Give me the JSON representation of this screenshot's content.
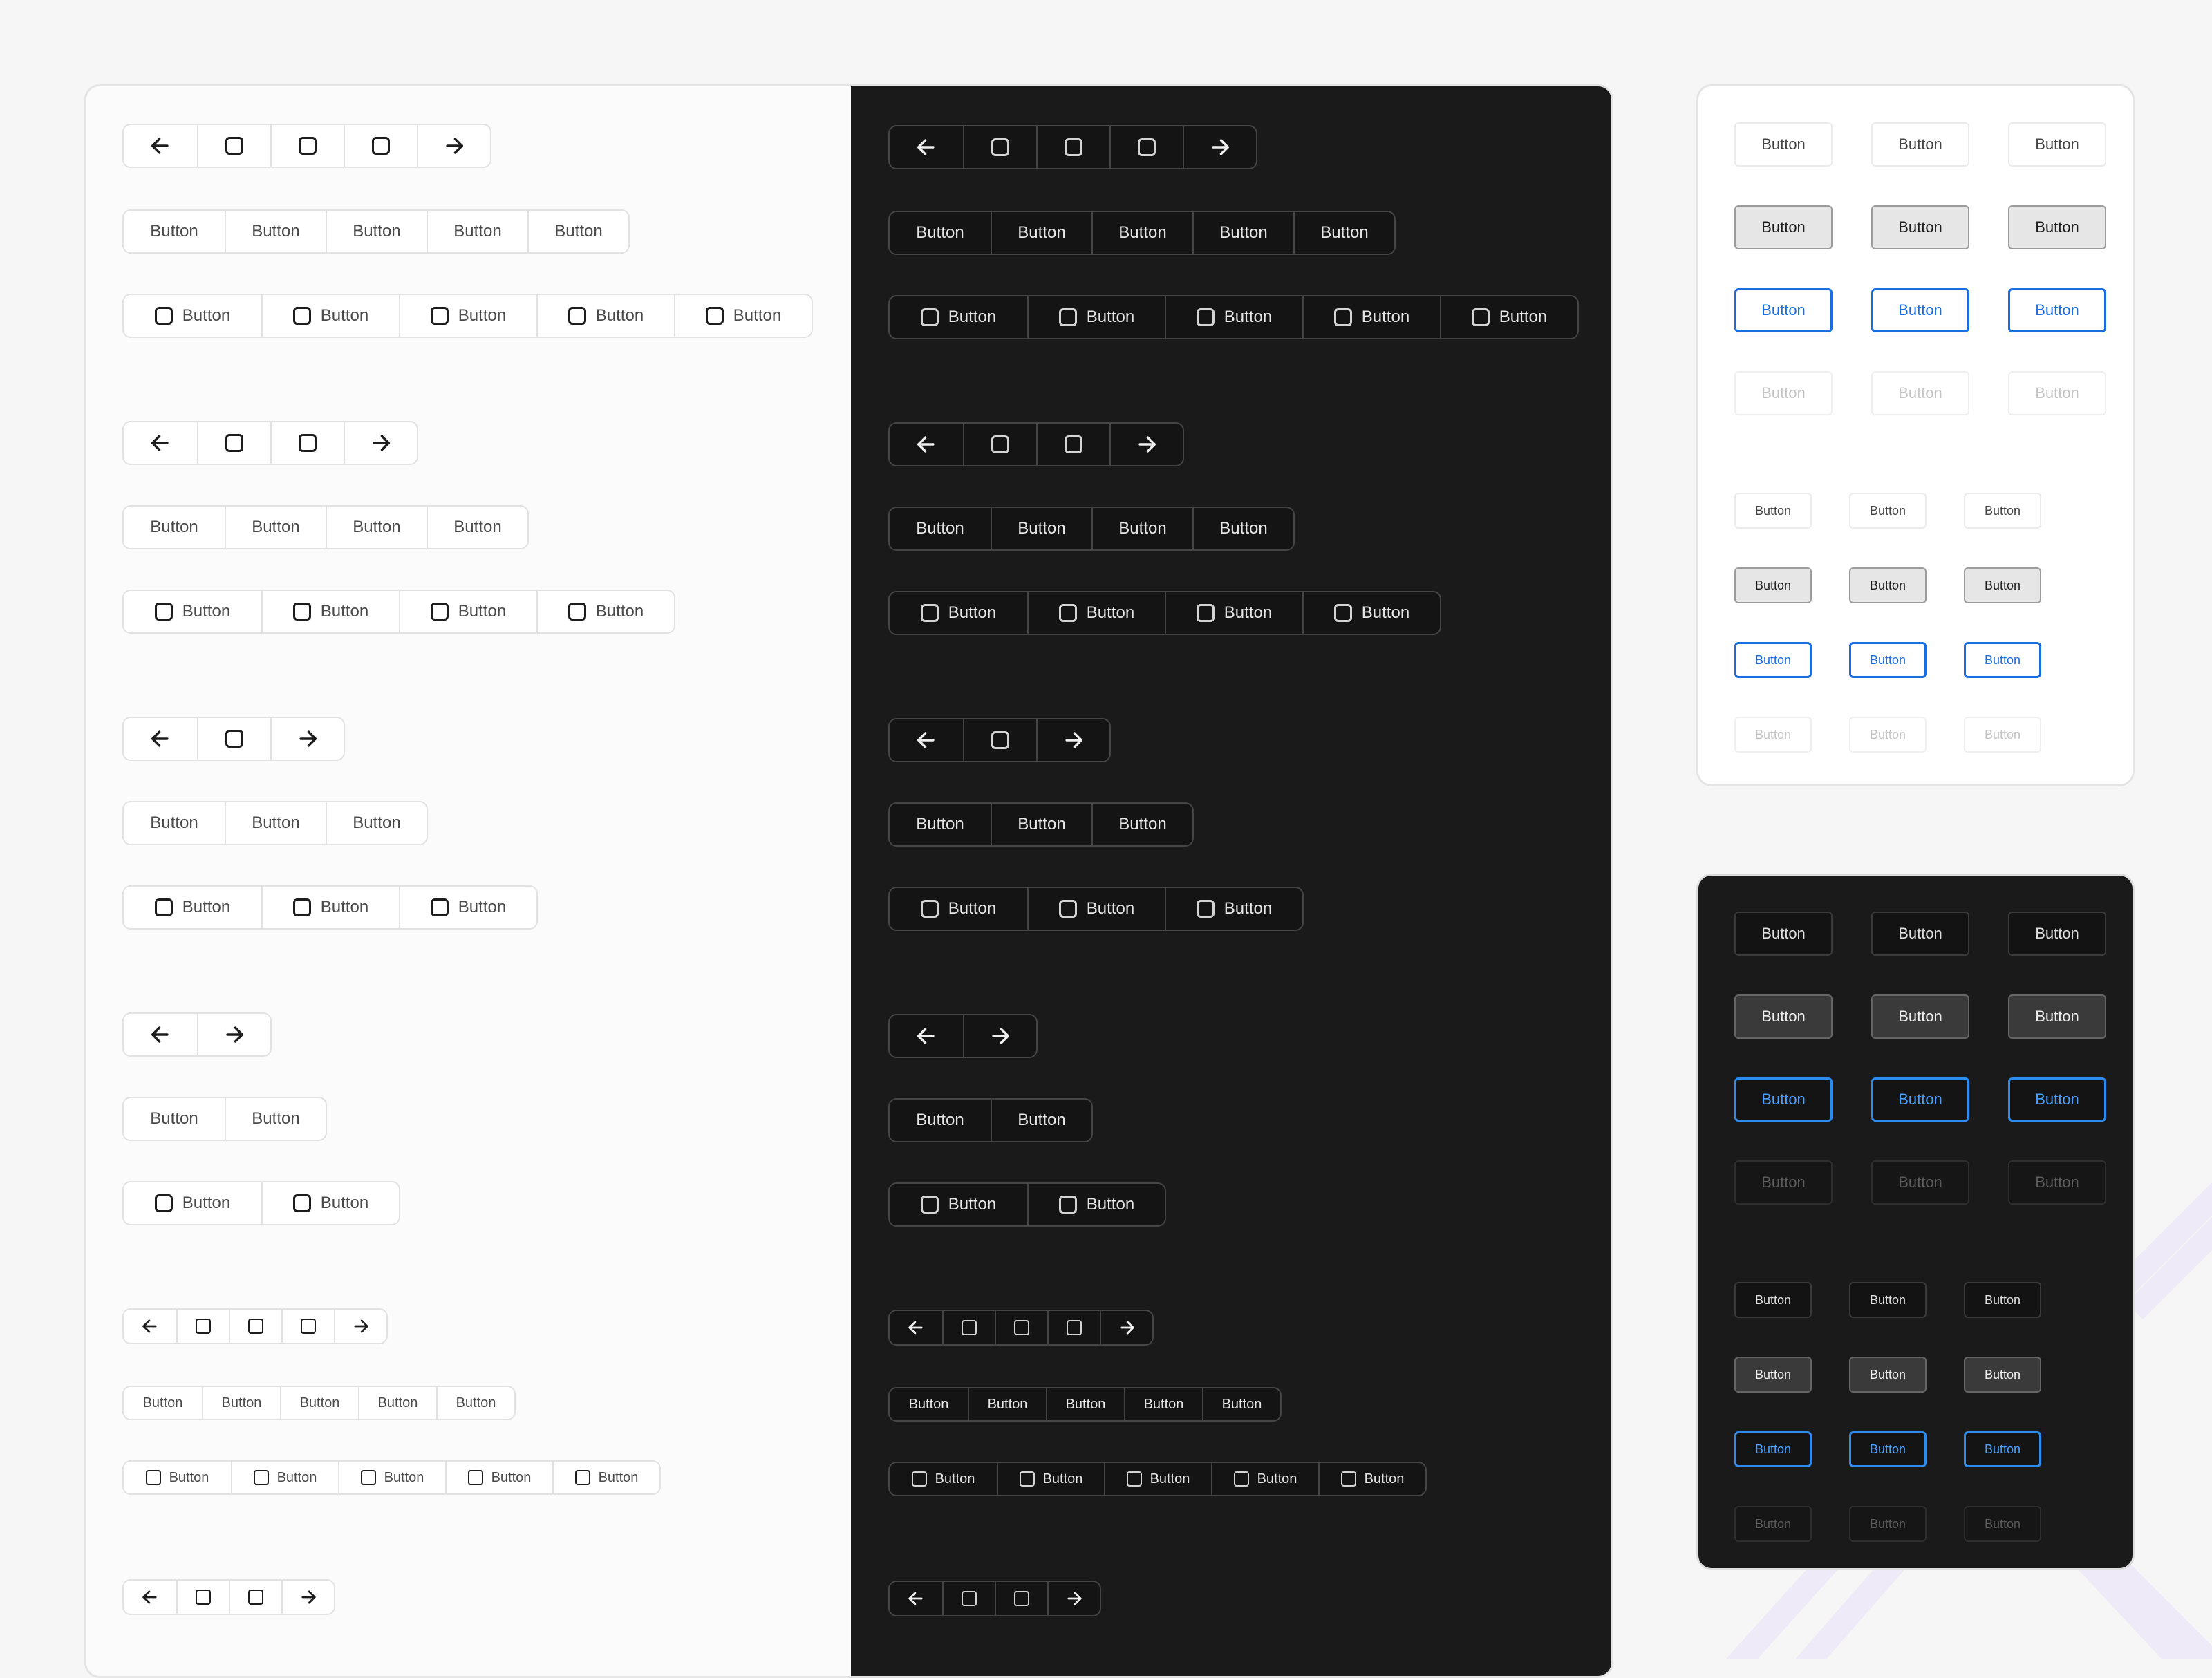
{
  "labels": {
    "button": "Button"
  },
  "icons": {
    "prev": "arrow-left-icon",
    "next": "arrow-right-icon",
    "square": "square-icon"
  },
  "variants": [
    "default",
    "pressed",
    "selected",
    "disabled"
  ],
  "colors": {
    "light_background": "#ffffff",
    "dark_background": "#1a1a1a",
    "selected_blue_light": "#1a6dde",
    "selected_blue_dark": "#2d8cf0",
    "pressed_gray_light": "#e6e6e6",
    "pressed_gray_dark": "#3a3a3a"
  }
}
